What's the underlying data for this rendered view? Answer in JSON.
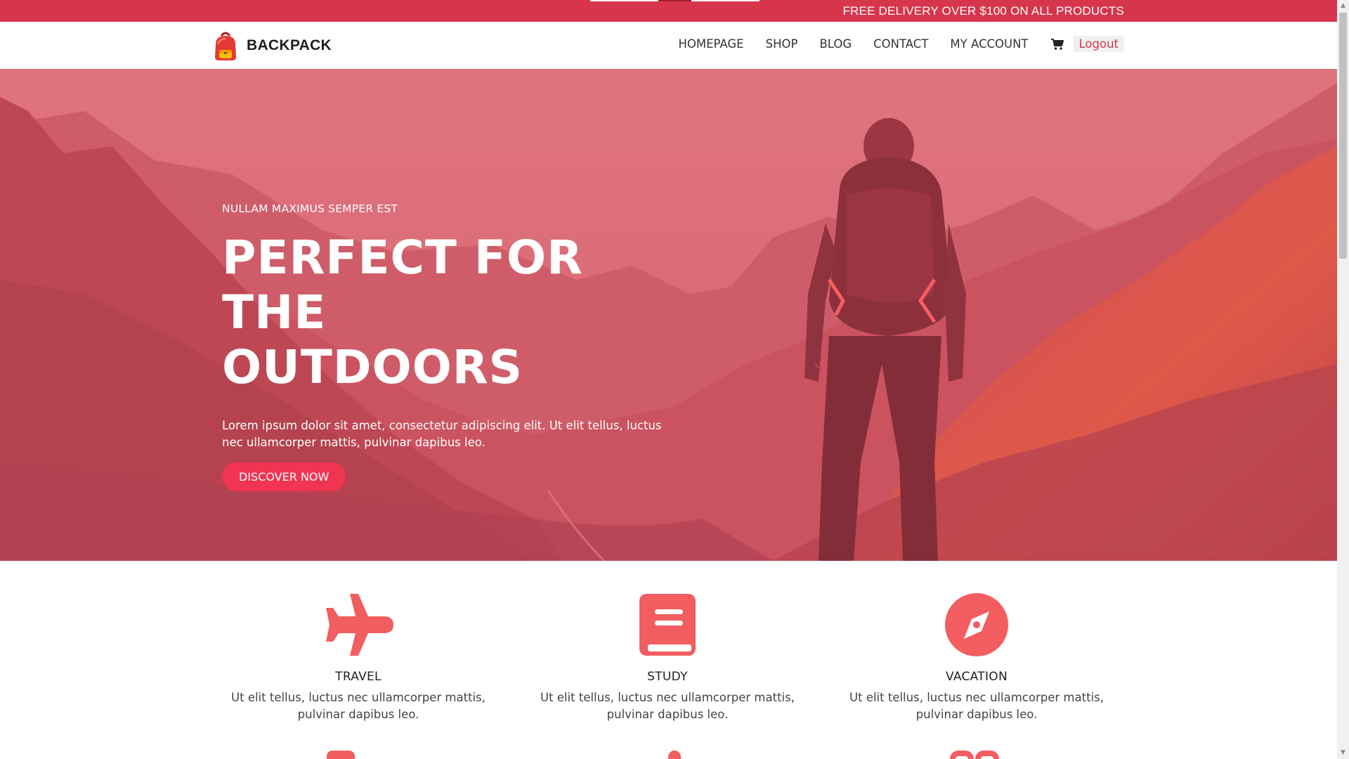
{
  "topbar": {
    "promo": "FREE DELIVERY OVER $100 ON ALL PRODUCTS"
  },
  "header": {
    "logo_text": "BACKPACK",
    "nav": {
      "homepage": "HOMEPAGE",
      "shop": "SHOP",
      "blog": "BLOG",
      "contact": "CONTACT",
      "my_account": "MY ACCOUNT",
      "logout": "Logout"
    },
    "cart_icon": "shopping-cart-icon"
  },
  "hero": {
    "kicker": "NULLAM MAXIMUS SEMPER EST",
    "title_line1": "PERFECT FOR THE",
    "title_line2": "OUTDOORS",
    "text": "Lorem ipsum dolor sit amet, consectetur adipiscing elit. Ut elit tellus, luctus nec ullamcorper mattis, pulvinar dapibus leo.",
    "button": "DISCOVER NOW"
  },
  "features": [
    {
      "icon": "airplane-icon",
      "title": "TRAVEL",
      "text": "Ut elit tellus, luctus nec ullamcorper mattis, pulvinar dapibus leo."
    },
    {
      "icon": "book-icon",
      "title": "STUDY",
      "text": "Ut elit tellus, luctus nec ullamcorper mattis, pulvinar dapibus leo."
    },
    {
      "icon": "compass-icon",
      "title": "VACATION",
      "text": "Ut elit tellus, luctus nec ullamcorper mattis, pulvinar dapibus leo."
    }
  ],
  "colors": {
    "brand": "#d7354c",
    "button": "#f03451",
    "icon": "#f25d60",
    "hero_overlay": "#d8717c"
  }
}
